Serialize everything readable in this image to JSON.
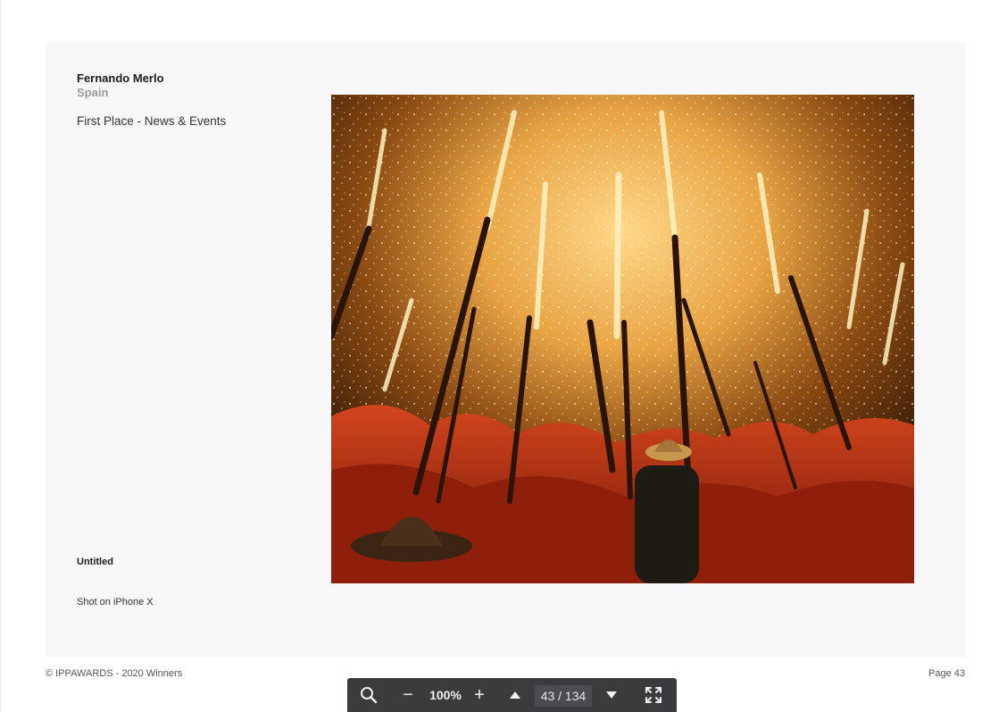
{
  "page": {
    "photographer_name": "Fernando Merlo",
    "country": "Spain",
    "award": "First Place - News & Events",
    "photo_title": "Untitled",
    "camera": "Shot on iPhone X"
  },
  "footer": {
    "copyright": "© IPPAWARDS - 2020 Winners",
    "page_label": "Page 43"
  },
  "toolbar": {
    "search_icon": "search-icon",
    "zoom_out_label": "−",
    "zoom_level": "100%",
    "zoom_in_label": "+",
    "prev_icon": "triangle-up-icon",
    "page_indicator": "43 / 134",
    "next_icon": "triangle-down-icon",
    "fullscreen_icon": "fullscreen-icon"
  },
  "colors": {
    "toolbar_bg": "#3a3b3d",
    "page_bg": "#f8f8fa",
    "secondary_text": "#9a9a9a"
  }
}
